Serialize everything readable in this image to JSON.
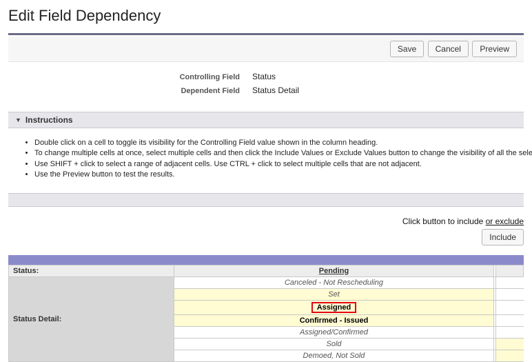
{
  "title": "Edit Field Dependency",
  "buttons": {
    "save": "Save",
    "cancel": "Cancel",
    "preview": "Preview",
    "include": "Include"
  },
  "fields": {
    "controlling_label": "Controlling Field",
    "controlling_value": "Status",
    "dependent_label": "Dependent Field",
    "dependent_value": "Status Detail"
  },
  "instructions": {
    "header": "Instructions",
    "items": [
      "Double click on a cell to toggle its visibility for the Controlling Field value shown in the column heading.",
      "To change multiple cells at once, select multiple cells and then click the Include Values or Exclude Values button to change the visibility of all the selected cells.",
      "Use SHIFT + click to select a range of adjacent cells. Use CTRL + click to select multiple cells that are not adjacent.",
      "Use the Preview button to test the results."
    ]
  },
  "hint_prefix": "Click button to include ",
  "hint_underlined": "or exclude",
  "grid": {
    "row_status_label": "Status:",
    "row_detail_label": "Status Detail:",
    "col1_header": "Pending",
    "rows": [
      {
        "label": "Canceled - Not Rescheduling",
        "selected": false,
        "bold": false,
        "boxed": false,
        "narrow_selected": false
      },
      {
        "label": "Set",
        "selected": true,
        "bold": false,
        "boxed": false,
        "narrow_selected": false
      },
      {
        "label": "Assigned",
        "selected": true,
        "bold": true,
        "boxed": true,
        "narrow_selected": false
      },
      {
        "label": "Confirmed - Issued",
        "selected": true,
        "bold": true,
        "boxed": false,
        "narrow_selected": false
      },
      {
        "label": "Assigned/Confirmed",
        "selected": false,
        "bold": false,
        "boxed": false,
        "narrow_selected": false
      },
      {
        "label": "Sold",
        "selected": false,
        "bold": false,
        "boxed": false,
        "narrow_selected": true
      },
      {
        "label": "Demoed, Not Sold",
        "selected": false,
        "bold": false,
        "boxed": false,
        "narrow_selected": true
      }
    ]
  }
}
